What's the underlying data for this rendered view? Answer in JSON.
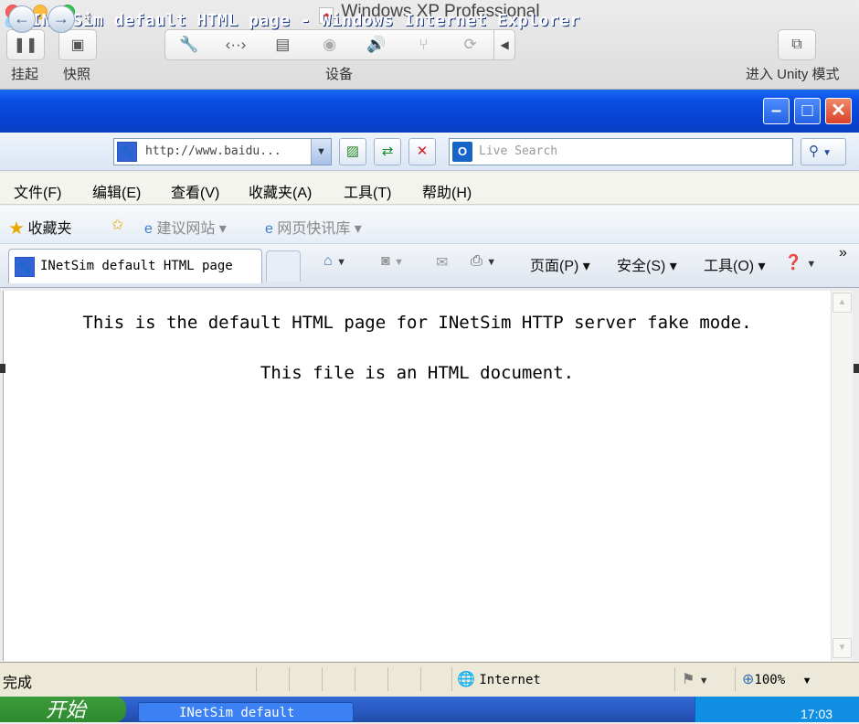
{
  "vm_window": {
    "title": "Windows XP Professional",
    "buttons": {
      "suspend_label": "挂起",
      "snapshot_label": "快照",
      "devices_label": "设备",
      "unity_label": "进入 Unity 模式"
    }
  },
  "ie": {
    "title": "INetSim default HTML page - Windows Internet Explorer",
    "address": "http://www.baidu...",
    "search_placeholder": "Live Search",
    "menu": [
      "文件(F)",
      "编辑(E)",
      "查看(V)",
      "收藏夹(A)",
      "工具(T)",
      "帮助(H)"
    ],
    "favorites_bar": {
      "favorites": "收藏夹",
      "suggested": "建议网站 ▾",
      "webslice": "网页快讯库 ▾"
    },
    "tab_label": "INetSim default HTML page",
    "command_bar": {
      "page": "页面(P) ▾",
      "safety": "安全(S) ▾",
      "tools": "工具(O) ▾",
      "more": "»"
    },
    "content": {
      "line1": "This is the default HTML page for INetSim HTTP server fake mode.",
      "line2": "This file is an HTML document."
    },
    "status": {
      "text": "完成",
      "zone": "Internet",
      "zoom": "100%"
    }
  },
  "taskbar": {
    "start_label": "开始",
    "task_label": "INetSim default",
    "clock": "17:03"
  },
  "colors": {
    "xp_title_blue": "#0543d2",
    "start_green": "#2e8a2e",
    "taskbar_blue": "#2a58c0"
  }
}
